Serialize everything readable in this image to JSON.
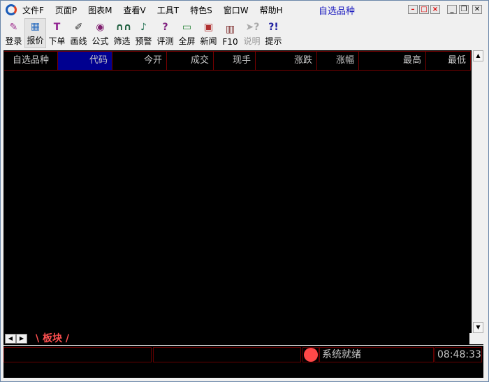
{
  "menu": [
    "文件F",
    "页面P",
    "图表M",
    "查看V",
    "工具T",
    "特色S",
    "窗口W",
    "帮助H"
  ],
  "mdi_title": "自选品种",
  "toolbar": [
    {
      "label": "登录",
      "icon": "pen-icon"
    },
    {
      "label": "报价",
      "icon": "quote-icon"
    },
    {
      "label": "下单",
      "icon": "order-icon"
    },
    {
      "label": "画线",
      "icon": "pencil-icon"
    },
    {
      "label": "公式",
      "icon": "formula-icon"
    },
    {
      "label": "筛选",
      "icon": "binoculars-icon"
    },
    {
      "label": "预警",
      "icon": "bell-icon"
    },
    {
      "label": "评测",
      "icon": "test-icon"
    },
    {
      "label": "全屏",
      "icon": "monitor-icon"
    },
    {
      "label": "新闻",
      "icon": "news-icon"
    },
    {
      "label": "F10",
      "icon": "books-icon"
    },
    {
      "label": "说明",
      "icon": "help-pointer-icon"
    },
    {
      "label": "提示",
      "icon": "tip-icon"
    }
  ],
  "columns": [
    "自选品种",
    "代码",
    "今开",
    "成交",
    "现手",
    "涨跌",
    "涨幅",
    "最高",
    "最低"
  ],
  "tab": "板块",
  "status": {
    "text": "系统就绪",
    "time": "08:48:33"
  },
  "colors": {
    "grid_bg": "#000000",
    "header_sel": "#000090",
    "border": "#770000",
    "tab": "#ff5050",
    "indicator": "#ff4848"
  }
}
